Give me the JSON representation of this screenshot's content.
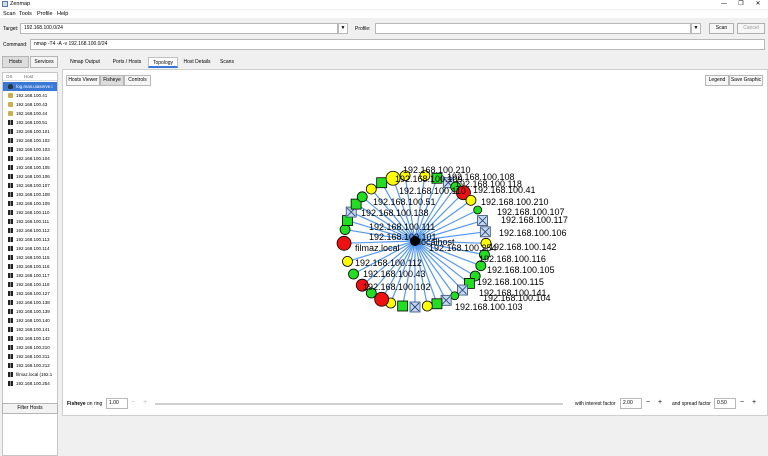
{
  "window": {
    "title": "Zenmap",
    "controls": [
      "—",
      "❐",
      "✕"
    ]
  },
  "menu": [
    "Scan",
    "Tools",
    "Profile",
    "Help"
  ],
  "target": {
    "label": "Target:",
    "value": "192.168.100.0/24"
  },
  "profile": {
    "label": "Profile:",
    "value": ""
  },
  "buttons": {
    "scan": "Scan",
    "cancel": "Cancel"
  },
  "command": {
    "label": "Command:",
    "value": "nmap -T4 -A -v 192.168.100.0/24"
  },
  "left_tabs": [
    "Hosts",
    "Services"
  ],
  "host_list": {
    "col_os": "OS",
    "col_host": "Host",
    "selected_index": 0,
    "hosts": [
      {
        "name": "fog.mas.uiaserve.i",
        "os": "linux"
      },
      {
        "name": "192.168.100.41",
        "os": "other"
      },
      {
        "name": "192.168.100.43",
        "os": "other"
      },
      {
        "name": "192.168.100.44",
        "os": "other"
      },
      {
        "name": "192.168.100.51",
        "os": "win"
      },
      {
        "name": "192.168.100.101",
        "os": "win"
      },
      {
        "name": "192.168.100.102",
        "os": "win"
      },
      {
        "name": "192.168.100.103",
        "os": "win"
      },
      {
        "name": "192.168.100.104",
        "os": "win"
      },
      {
        "name": "192.168.100.105",
        "os": "win"
      },
      {
        "name": "192.168.100.106",
        "os": "win"
      },
      {
        "name": "192.168.100.107",
        "os": "win"
      },
      {
        "name": "192.168.100.108",
        "os": "win"
      },
      {
        "name": "192.168.100.109",
        "os": "win"
      },
      {
        "name": "192.168.100.110",
        "os": "win"
      },
      {
        "name": "192.168.100.111",
        "os": "win"
      },
      {
        "name": "192.168.100.112",
        "os": "win"
      },
      {
        "name": "192.168.100.113",
        "os": "win"
      },
      {
        "name": "192.168.100.114",
        "os": "win"
      },
      {
        "name": "192.168.100.115",
        "os": "win"
      },
      {
        "name": "192.168.100.116",
        "os": "win"
      },
      {
        "name": "192.168.100.117",
        "os": "win"
      },
      {
        "name": "192.168.100.118",
        "os": "win"
      },
      {
        "name": "192.168.100.127",
        "os": "win"
      },
      {
        "name": "192.168.100.138",
        "os": "win"
      },
      {
        "name": "192.168.100.139",
        "os": "win"
      },
      {
        "name": "192.168.100.140",
        "os": "win"
      },
      {
        "name": "192.168.100.141",
        "os": "win"
      },
      {
        "name": "192.168.100.142",
        "os": "win"
      },
      {
        "name": "192.168.100.210",
        "os": "win"
      },
      {
        "name": "192.168.100.211",
        "os": "win"
      },
      {
        "name": "192.168.100.212",
        "os": "win"
      },
      {
        "name": "filmaz.local (192.1",
        "os": "win"
      },
      {
        "name": "192.168.100.254",
        "os": "win"
      }
    ],
    "filter_button": "Filter Hosts"
  },
  "main_tabs": [
    "Nmap Output",
    "Ports / Hosts",
    "Topology",
    "Host Details",
    "Scans"
  ],
  "active_main_tab": 2,
  "topology": {
    "toggles": [
      "Hosts Viewer",
      "Fisheye",
      "Controls"
    ],
    "active_toggle": 1,
    "legend_button": "Legend",
    "save_button": "Save Graphic",
    "bottom": {
      "fisheye_label_bold": "Fisheye",
      "fisheye_label_rest": " on ring",
      "ring_value": "1.00",
      "interest_label": "with interest factor",
      "interest_value": "2.00",
      "spread_label": "and spread factor",
      "spread_value": "0.50"
    },
    "center_label": "localhost",
    "labels": [
      "192.168.100.108",
      "192.168.100.118",
      "192.168.100.41",
      "192.168.100.210",
      "192.168.100.107",
      "192.168.100.117",
      "192.168.100.106",
      "192.168.100.142",
      "192.168.100.116",
      "192.168.100.105",
      "192.168.100.115",
      "192.168.100.141",
      "192.168.100.104",
      "192.168.100.103",
      "192.168.100.102",
      "192.168.100.43",
      "192.168.100.112",
      "filmaz.local",
      "192.168.100.254",
      "192.168.100.101",
      "192.168.100.111",
      "192.168.100.138",
      "192.168.100.51",
      "192.168.100.109",
      "192.168.100.110",
      "192.168.100.210"
    ],
    "colors": {
      "green": "#22dd22",
      "yellow": "#ffff00",
      "red": "#ee1111",
      "edge": "#5599ee",
      "selection": "#3a78d6"
    }
  }
}
